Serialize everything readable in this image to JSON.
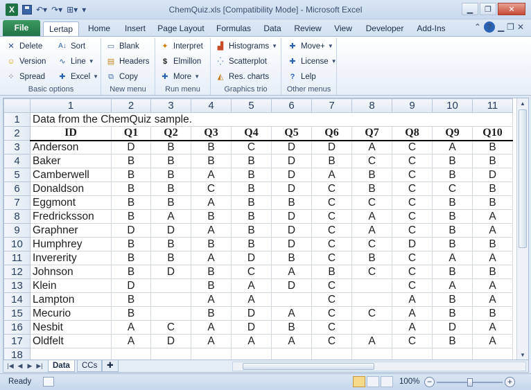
{
  "window": {
    "title": "ChemQuiz.xls  [Compatibility Mode]  -  Microsoft Excel",
    "app_logo": "X"
  },
  "tabs": {
    "file": "File",
    "items": [
      "Lertap",
      "Home",
      "Insert",
      "Page Layout",
      "Formulas",
      "Data",
      "Review",
      "View",
      "Developer",
      "Add-Ins"
    ],
    "active": "Lertap"
  },
  "ribbon": {
    "basic_options": {
      "label": "Basic options",
      "delete": "Delete",
      "version": "Version",
      "spread": "Spread",
      "sort": "Sort",
      "line": "Line",
      "excel": "Excel"
    },
    "new_menu": {
      "label": "New menu",
      "blank": "Blank",
      "headers": "Headers",
      "copy": "Copy"
    },
    "run_menu": {
      "label": "Run menu",
      "interpret": "Interpret",
      "elmillon": "Elmillon",
      "more": "More"
    },
    "graphics_trio": {
      "label": "Graphics trio",
      "histograms": "Histograms",
      "scatterplot": "Scatterplot",
      "res_charts": "Res. charts"
    },
    "other_menus": {
      "label": "Other menus",
      "move": "Move+",
      "license": "License",
      "lelp": "Lelp"
    }
  },
  "sheet": {
    "column_numbers": [
      "1",
      "2",
      "3",
      "4",
      "5",
      "6",
      "7",
      "8",
      "9",
      "10",
      "11"
    ],
    "row_numbers": [
      "1",
      "2",
      "3",
      "4",
      "5",
      "6",
      "7",
      "8",
      "9",
      "10",
      "11",
      "12",
      "13",
      "14",
      "15",
      "16",
      "17",
      "18"
    ],
    "title_cell": "Data from the ChemQuiz sample.",
    "headers": [
      "ID",
      "Q1",
      "Q2",
      "Q3",
      "Q4",
      "Q5",
      "Q6",
      "Q7",
      "Q8",
      "Q9",
      "Q10"
    ],
    "rows": [
      [
        "Anderson",
        "D",
        "B",
        "B",
        "C",
        "D",
        "D",
        "A",
        "C",
        "A",
        "B"
      ],
      [
        "Baker",
        "B",
        "B",
        "B",
        "B",
        "D",
        "B",
        "C",
        "C",
        "B",
        "B"
      ],
      [
        "Camberwell",
        "B",
        "B",
        "A",
        "B",
        "D",
        "A",
        "B",
        "C",
        "B",
        "D"
      ],
      [
        "Donaldson",
        "B",
        "B",
        "C",
        "B",
        "D",
        "C",
        "B",
        "C",
        "C",
        "B"
      ],
      [
        "Eggmont",
        "B",
        "B",
        "A",
        "B",
        "B",
        "C",
        "C",
        "C",
        "B",
        "B"
      ],
      [
        "Fredricksson",
        "B",
        "A",
        "B",
        "B",
        "D",
        "C",
        "A",
        "C",
        "B",
        "A"
      ],
      [
        "Graphner",
        "D",
        "D",
        "A",
        "B",
        "D",
        "C",
        "A",
        "C",
        "B",
        "A"
      ],
      [
        "Humphrey",
        "B",
        "B",
        "B",
        "B",
        "D",
        "C",
        "C",
        "D",
        "B",
        "B"
      ],
      [
        "Invererity",
        "B",
        "B",
        "A",
        "D",
        "B",
        "C",
        "B",
        "C",
        "A",
        "A"
      ],
      [
        "Johnson",
        "B",
        "D",
        "B",
        "C",
        "A",
        "B",
        "C",
        "C",
        "B",
        "B"
      ],
      [
        "Klein",
        "D",
        "",
        "B",
        "A",
        "D",
        "C",
        "",
        "C",
        "A",
        "A"
      ],
      [
        "Lampton",
        "B",
        "",
        "A",
        "A",
        "",
        "C",
        "",
        "A",
        "B",
        "A"
      ],
      [
        "Mecurio",
        "B",
        "",
        "B",
        "D",
        "A",
        "C",
        "C",
        "A",
        "B",
        "B"
      ],
      [
        "Nesbit",
        "A",
        "C",
        "A",
        "D",
        "B",
        "C",
        "",
        "A",
        "D",
        "A"
      ],
      [
        "Oldfelt",
        "A",
        "D",
        "A",
        "A",
        "A",
        "C",
        "A",
        "C",
        "B",
        "A"
      ]
    ]
  },
  "sheet_tabs": [
    "Data",
    "CCs"
  ],
  "status": {
    "ready": "Ready",
    "zoom": "100%",
    "zoom_fraction": 0.5
  }
}
